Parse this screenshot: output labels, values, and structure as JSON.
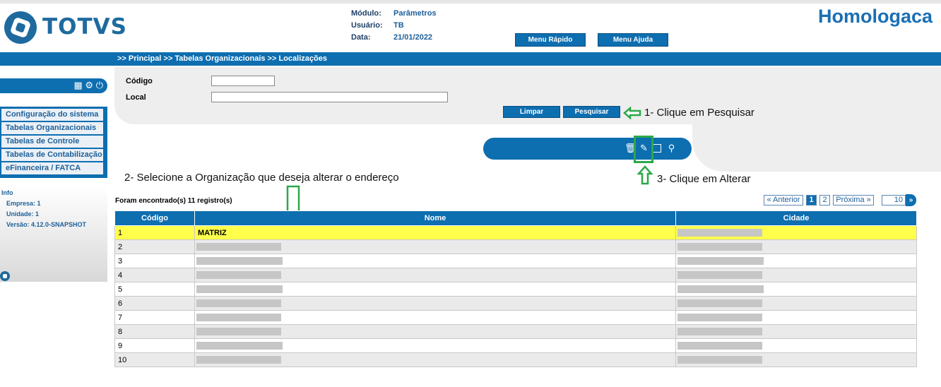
{
  "header": {
    "logo_text": "TOTVS",
    "modulo_label": "Módulo:",
    "modulo_value": "Parâmetros",
    "usuario_label": "Usuário:",
    "usuario_value": "TB",
    "data_label": "Data:",
    "data_value": "21/01/2022",
    "menu_rapido": "Menu Rápido",
    "menu_ajuda": "Menu Ajuda",
    "environment": "Homologaca"
  },
  "breadcrumb": ">> Principal >> Tabelas Organizacionais >> Localizações",
  "sidebar": {
    "items": [
      {
        "label": "Configuração do sistema"
      },
      {
        "label": "Tabelas Organizacionais"
      },
      {
        "label": "Tabelas de Controle"
      },
      {
        "label": "Tabelas de Contabilização"
      },
      {
        "label": "eFinanceira / FATCA"
      }
    ],
    "info_title": "Info",
    "empresa": "Empresa: 1",
    "unidade": "Unidade: 1",
    "versao": "Versão: 4.12.0-SNAPSHOT"
  },
  "search": {
    "codigo_label": "Código",
    "codigo_value": "",
    "local_label": "Local",
    "local_value": "",
    "limpar": "Limpar",
    "pesquisar": "Pesquisar"
  },
  "annotations": {
    "step1": "1- Clique em Pesquisar",
    "step2": "2- Selecione a Organização que deseja alterar o endereço",
    "step3": "3- Clique em Alterar"
  },
  "results": {
    "count_text": "Foram encontrado(s) 11 registro(s)",
    "pagination": {
      "prev": "« Anterior",
      "pages": [
        "1",
        "2"
      ],
      "current_page": "1",
      "next": "Próxima »",
      "page_size": "10"
    },
    "columns": [
      "Código",
      "Nome",
      "Cidade"
    ],
    "rows": [
      {
        "codigo": "1",
        "nome": "MATRIZ",
        "selected": true
      },
      {
        "codigo": "2",
        "nome": ""
      },
      {
        "codigo": "3",
        "nome": ""
      },
      {
        "codigo": "4",
        "nome": ""
      },
      {
        "codigo": "5",
        "nome": ""
      },
      {
        "codigo": "6",
        "nome": ""
      },
      {
        "codigo": "7",
        "nome": ""
      },
      {
        "codigo": "8",
        "nome": ""
      },
      {
        "codigo": "9",
        "nome": ""
      },
      {
        "codigo": "10",
        "nome": ""
      }
    ]
  },
  "colors": {
    "primary": "#0d6eb0",
    "selected_row": "#ffff4c",
    "annotation_green": "#2ca84a"
  }
}
